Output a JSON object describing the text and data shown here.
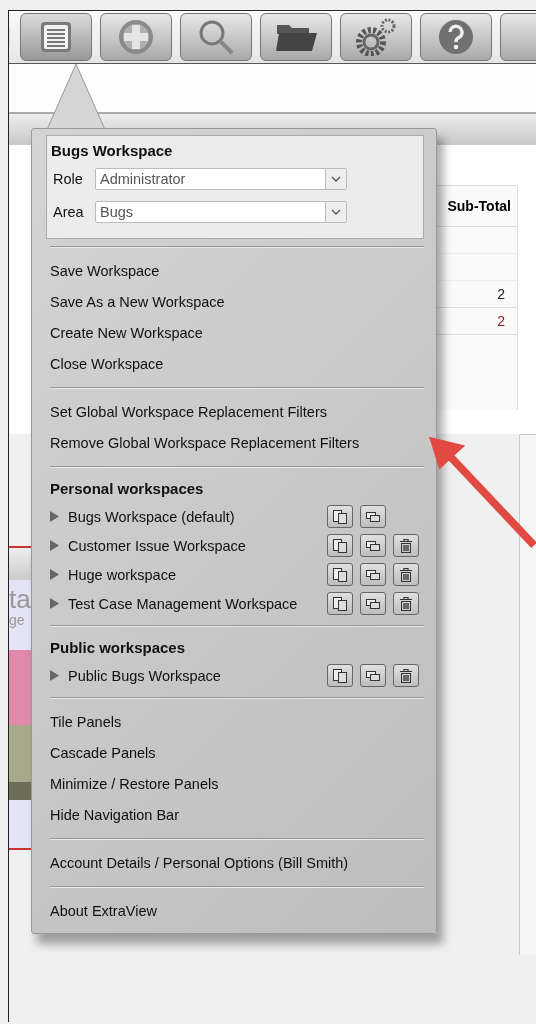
{
  "toolbar": {
    "buttons": [
      {
        "kind": "list",
        "selected": true
      },
      {
        "kind": "add",
        "selected": false
      },
      {
        "kind": "search",
        "selected": false
      },
      {
        "kind": "folder",
        "selected": false
      },
      {
        "kind": "gears",
        "selected": false
      },
      {
        "kind": "help",
        "selected": false
      },
      {
        "kind": "partial",
        "selected": false
      }
    ]
  },
  "table": {
    "column_heading": "Sub-Total",
    "cells": [
      {
        "text": "2",
        "color": "#222222"
      },
      {
        "text": "2",
        "color": "#8b1a1a"
      }
    ]
  },
  "chart_panel": {
    "title_fragment": "ta",
    "subtitle_fragment": "ge"
  },
  "menu": {
    "header": {
      "title": "Bugs Workspace",
      "fields": [
        {
          "label": "Role",
          "value": "Administrator"
        },
        {
          "label": "Area",
          "value": "Bugs"
        }
      ]
    },
    "sections": [
      {
        "items": [
          {
            "kind": "action",
            "label": "Save Workspace"
          },
          {
            "kind": "action",
            "label": "Save As a New Workspace"
          },
          {
            "kind": "action",
            "label": "Create New Workspace"
          },
          {
            "kind": "action",
            "label": "Close Workspace"
          }
        ]
      },
      {
        "items": [
          {
            "kind": "action",
            "label": "Set Global Workspace Replacement Filters"
          },
          {
            "kind": "action",
            "label": "Remove Global Workspace Replacement Filters"
          }
        ]
      },
      {
        "heading": "Personal workspaces",
        "items": [
          {
            "kind": "workspace",
            "label": "Bugs Workspace (default)",
            "actions": [
              {
                "kind": "copy"
              },
              {
                "kind": "rename"
              }
            ]
          },
          {
            "kind": "workspace",
            "label": "Customer Issue Workspace",
            "actions": [
              {
                "kind": "copy"
              },
              {
                "kind": "rename"
              },
              {
                "kind": "delete"
              }
            ]
          },
          {
            "kind": "workspace",
            "label": "Huge workspace",
            "actions": [
              {
                "kind": "copy"
              },
              {
                "kind": "rename"
              },
              {
                "kind": "delete"
              }
            ]
          },
          {
            "kind": "workspace",
            "label": "Test Case Management Workspace",
            "actions": [
              {
                "kind": "copy"
              },
              {
                "kind": "rename"
              },
              {
                "kind": "delete"
              }
            ]
          }
        ]
      },
      {
        "heading": "Public workspaces",
        "items": [
          {
            "kind": "workspace",
            "label": "Public Bugs Workspace",
            "actions": [
              {
                "kind": "copy"
              },
              {
                "kind": "rename"
              },
              {
                "kind": "delete"
              }
            ]
          }
        ]
      },
      {
        "items": [
          {
            "kind": "action",
            "label": "Tile Panels"
          },
          {
            "kind": "action",
            "label": "Cascade Panels"
          },
          {
            "kind": "action",
            "label": "Minimize / Restore Panels"
          },
          {
            "kind": "action",
            "label": "Hide Navigation Bar"
          }
        ]
      },
      {
        "items": [
          {
            "kind": "action",
            "label": "Account Details / Personal Options (Bill Smith)"
          }
        ]
      },
      {
        "items": [
          {
            "kind": "action",
            "label": "About ExtraView"
          }
        ]
      }
    ]
  }
}
